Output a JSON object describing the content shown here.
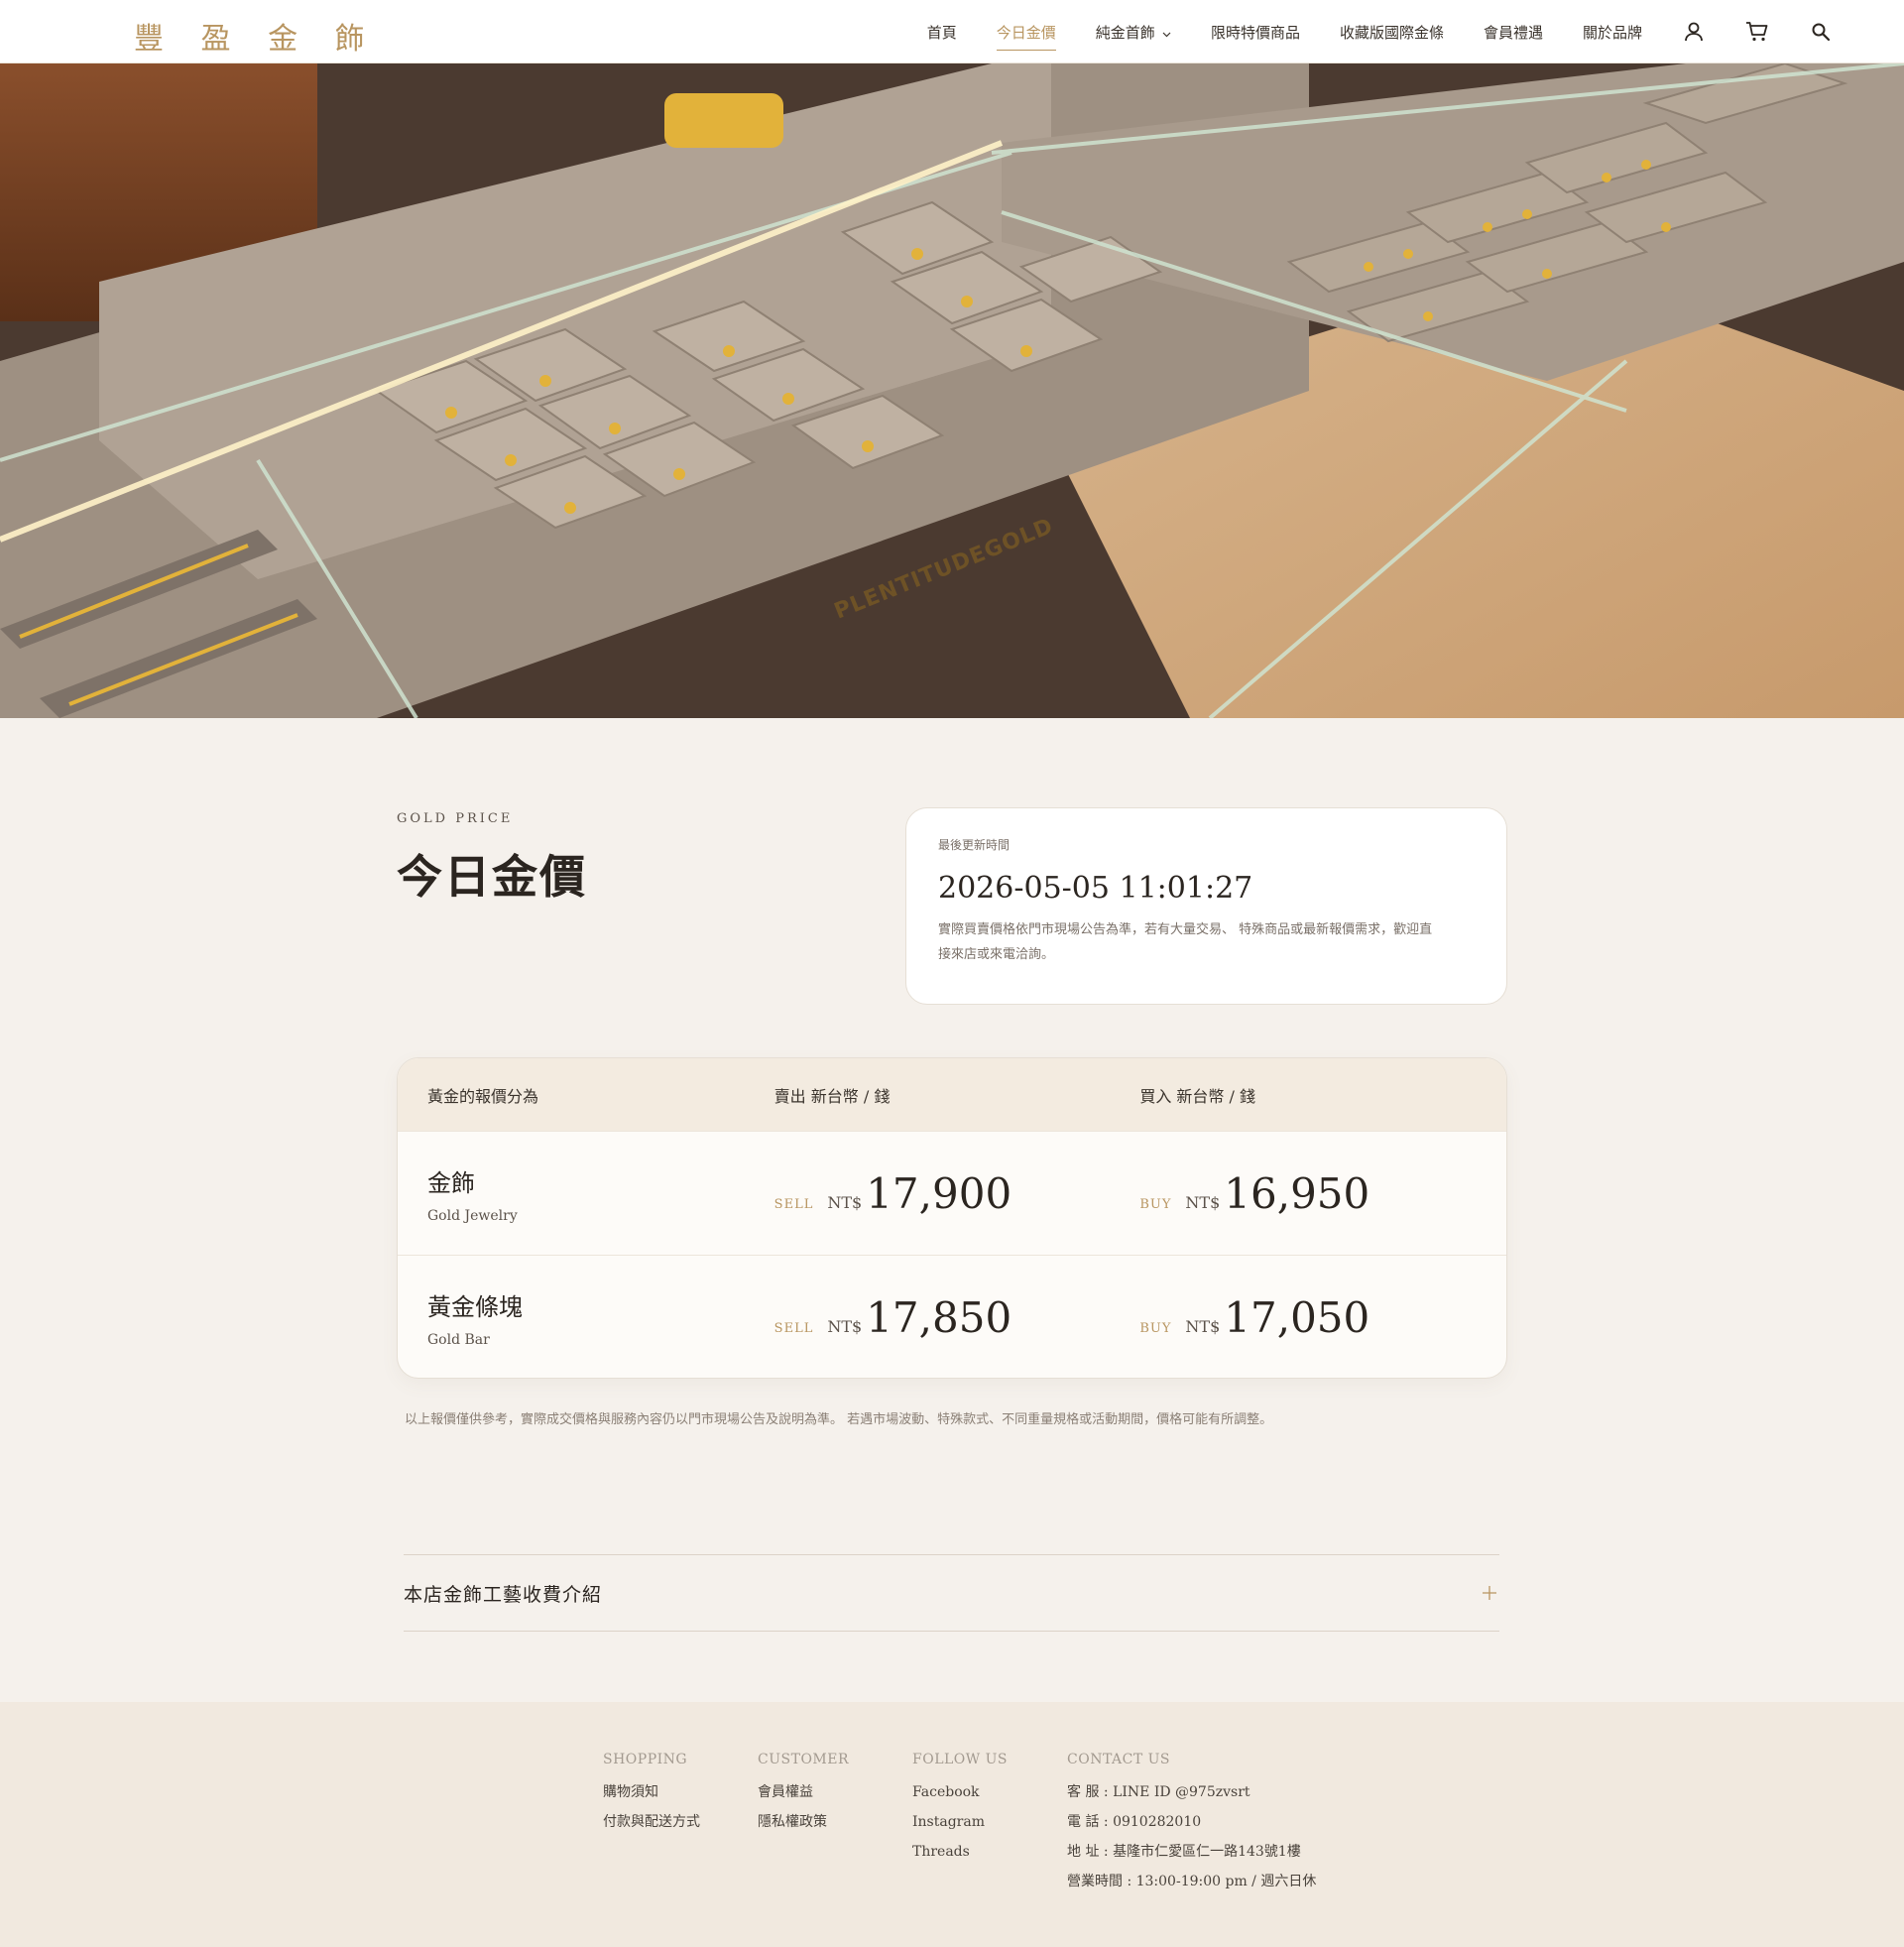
{
  "header": {
    "logo": "豐 盈 金 飾",
    "nav": [
      {
        "label": "首頁",
        "active": false
      },
      {
        "label": "今日金價",
        "active": true
      },
      {
        "label": "純金首飾",
        "active": false,
        "has_dropdown": true
      },
      {
        "label": "限時特價商品",
        "active": false
      },
      {
        "label": "收藏版國際金條",
        "active": false
      },
      {
        "label": "會員禮遇",
        "active": false
      },
      {
        "label": "關於品牌",
        "active": false
      }
    ],
    "icons": [
      "user-icon",
      "cart-icon",
      "search-icon"
    ]
  },
  "hero": {
    "brand_engraving": "PLENTITUDEGOLD"
  },
  "main": {
    "eyebrow": "GOLD PRICE",
    "title": "今日金價",
    "update": {
      "label": "最後更新時間",
      "time": "2026-05-05 11:01:27",
      "note_line1": "實際買賣價格依門市現場公告為準，若有大量交易、 特殊商品或最新報價需求，歡迎直",
      "note_line2": "接來店或來電洽詢。"
    },
    "table": {
      "headers": [
        "黃金的報價分為",
        "賣出 新台幣 / 錢",
        "買入 新台幣 / 錢"
      ],
      "sell_tag": "SELL",
      "buy_tag": "BUY",
      "currency": "NT$",
      "rows": [
        {
          "name": "金飾",
          "name_en": "Gold Jewelry",
          "sell": "17,900",
          "buy": "16,950"
        },
        {
          "name": "黃金條塊",
          "name_en": "Gold Bar",
          "sell": "17,850",
          "buy": "17,050"
        }
      ]
    },
    "disclaimer": "以上報價僅供參考，實際成交價格與服務內容仍以門市現場公告及說明為準。 若遇市場波動、特殊款式、不同重量規格或活動期間，價格可能有所調整。",
    "accordion_title": "本店金飾工藝收費介紹"
  },
  "footer": {
    "shopping": {
      "title": "SHOPPING",
      "items": [
        "購物須知",
        "付款與配送方式"
      ]
    },
    "customer": {
      "title": "CUSTOMER",
      "items": [
        "會員權益",
        "隱私權政策"
      ]
    },
    "follow": {
      "title": "FOLLOW US",
      "items": [
        "Facebook",
        "Instagram",
        "Threads"
      ]
    },
    "contact": {
      "title": "CONTACT US",
      "items": [
        "客 服 : LINE ID @975zvsrt",
        "電 話 : 0910282010",
        "地 址 : 基隆市仁愛區仁一路143號1樓",
        "營業時間 : 13:00-19:00 pm / 週六日休"
      ]
    }
  },
  "colors": {
    "accent": "#b89560",
    "background": "#f5f1ec",
    "footer": "#f1e9df"
  }
}
